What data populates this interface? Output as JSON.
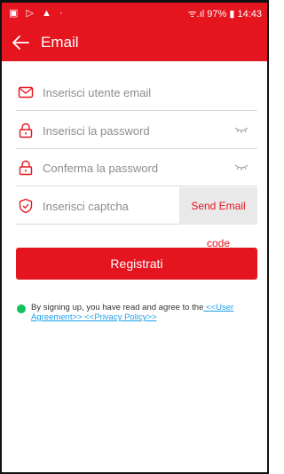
{
  "status_bar": {
    "left_icons": "▣ ▷ ▲ ·",
    "right_text": "ᯤ.ıl 97% ▮ 14:43"
  },
  "app_bar": {
    "title": "Email"
  },
  "form": {
    "email_placeholder": "Inserisci utente email",
    "password_placeholder": "Inserisci la password",
    "confirm_placeholder": "Conferma la password",
    "captcha_placeholder": "Inserisci captcha",
    "send_code_label": "Send Email code"
  },
  "register_label": "Registrati",
  "agreement": {
    "text": "By signing up, you have read and agree to the",
    "user_agreement_link": " <<User Agreement>>",
    "privacy_link": " <<Privacy Policy>>"
  },
  "colors": {
    "accent": "#e5151f",
    "checkbox": "#10c25a",
    "link": "#1aa0e8"
  }
}
